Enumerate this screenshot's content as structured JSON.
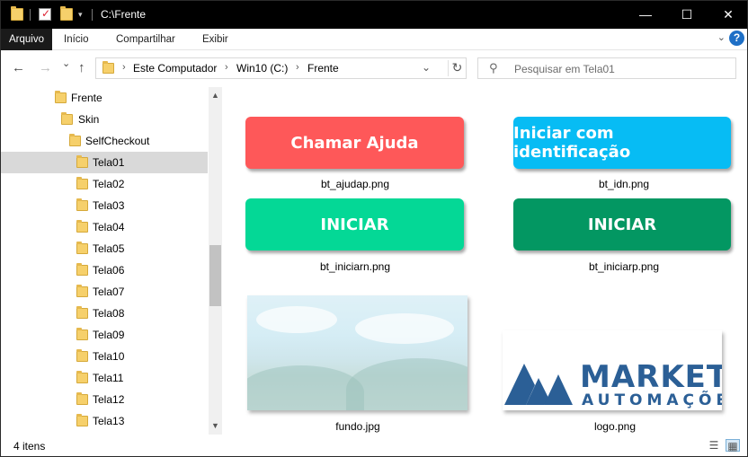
{
  "window": {
    "title": "C:\\Frente",
    "controls": {
      "minimize": "—",
      "maximize": "☐",
      "close": "✕"
    }
  },
  "ribbon": {
    "tabs": [
      {
        "label": "Arquivo",
        "active": true
      },
      {
        "label": "Início"
      },
      {
        "label": "Compartilhar"
      },
      {
        "label": "Exibir"
      }
    ],
    "expand_icon": "chevron-down-icon",
    "help_label": "?"
  },
  "nav": {
    "back": "←",
    "forward": "→",
    "recent": "⌄",
    "up": "↑",
    "breadcrumb": [
      "Este Computador",
      "Win10 (C:)",
      "Frente"
    ],
    "separator": "›",
    "refresh": "↻",
    "dropdown": "⌄"
  },
  "search": {
    "placeholder": "Pesquisar em Tela01",
    "icon": "⚲"
  },
  "tree": {
    "items": [
      {
        "label": "Frente",
        "level": 0
      },
      {
        "label": "Skin",
        "level": 1
      },
      {
        "label": "SelfCheckout",
        "level": 2
      },
      {
        "label": "Tela01",
        "level": 3,
        "selected": true
      },
      {
        "label": "Tela02",
        "level": 3
      },
      {
        "label": "Tela03",
        "level": 3
      },
      {
        "label": "Tela04",
        "level": 3
      },
      {
        "label": "Tela05",
        "level": 3
      },
      {
        "label": "Tela06",
        "level": 3
      },
      {
        "label": "Tela07",
        "level": 3
      },
      {
        "label": "Tela08",
        "level": 3
      },
      {
        "label": "Tela09",
        "level": 3
      },
      {
        "label": "Tela10",
        "level": 3
      },
      {
        "label": "Tela11",
        "level": 3
      },
      {
        "label": "Tela12",
        "level": 3
      },
      {
        "label": "Tela13",
        "level": 3
      }
    ],
    "scroll_up": "▲",
    "scroll_down": "▼"
  },
  "files": [
    {
      "name": "bt_ajudap.png",
      "kind": "button",
      "text": "Chamar Ajuda",
      "color": "#fe5859"
    },
    {
      "name": "bt_idn.png",
      "kind": "button",
      "text": "Iniciar com identificação",
      "color": "#07bcf4"
    },
    {
      "name": "bt_iniciarn.png",
      "kind": "button",
      "text": "INICIAR",
      "color": "#04d896"
    },
    {
      "name": "bt_iniciarp.png",
      "kind": "button",
      "text": "INICIAR",
      "color": "#039762"
    },
    {
      "name": "fundo.jpg",
      "kind": "photo"
    },
    {
      "name": "logo.png",
      "kind": "logo",
      "logo_text_1": "MARKET",
      "logo_text_2": "AUTOMAÇÕES",
      "color": "#2b5f96"
    }
  ],
  "status": {
    "count_text": "4 itens",
    "view_details_icon": "details-view-icon",
    "view_large_icon": "large-icons-view-icon"
  }
}
